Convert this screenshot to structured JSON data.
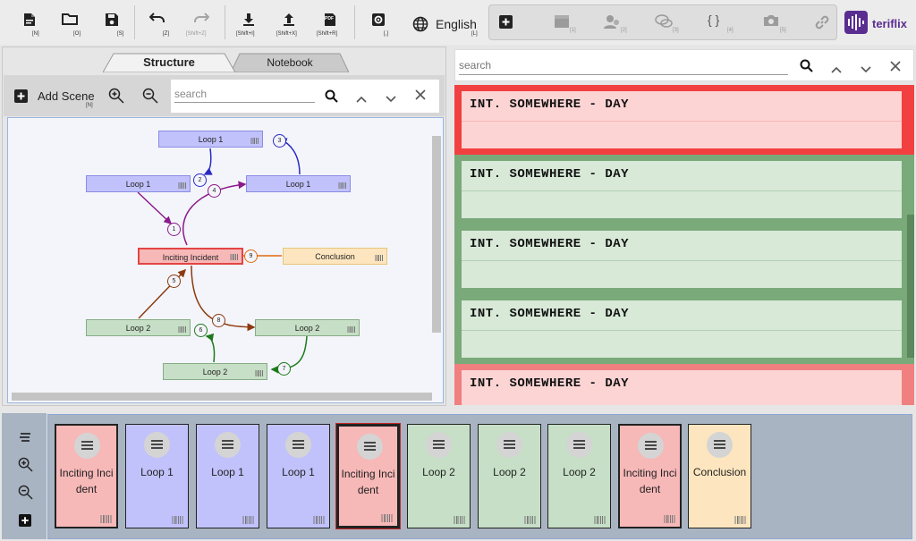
{
  "toolbar": {
    "new_sc": "[N]",
    "open_sc": "[O]",
    "save_sc": "[S]",
    "undo_sc": "[Z]",
    "redo_sc": "[Shift+Z]",
    "import_sc": "[Shift+I]",
    "export_sc": "[Shift+X]",
    "pdf_sc": "[Shift+R]",
    "pdf_badge": "PDF",
    "settings_sc": "[,]",
    "language": "English",
    "language_sc": "[L]",
    "scene_tools_sc": [
      "[1]",
      "[2]",
      "[3]",
      "[4]",
      "[5]"
    ],
    "braces": "{ }",
    "brand": "teriflix"
  },
  "structure": {
    "tabs": [
      "Structure",
      "Notebook"
    ],
    "add_scene_label": "Add Scene",
    "add_scene_sc": "[N]",
    "search_placeholder": "search",
    "nodes": [
      {
        "label": "Loop 1",
        "color": "blue"
      },
      {
        "label": "Loop 1",
        "color": "blue"
      },
      {
        "label": "Loop 1",
        "color": "blue"
      },
      {
        "label": "Inciting Incident",
        "color": "red"
      },
      {
        "label": "Conclusion",
        "color": "yellow"
      },
      {
        "label": "Loop 2",
        "color": "green"
      },
      {
        "label": "Loop 2",
        "color": "green"
      },
      {
        "label": "Loop 2",
        "color": "green"
      }
    ],
    "edges": [
      "1",
      "2",
      "3",
      "4",
      "5",
      "6",
      "7",
      "8",
      "9"
    ]
  },
  "screenplay": {
    "search_placeholder": "search",
    "scenes": [
      {
        "heading": "INT. SOMEWHERE - DAY",
        "color": "red",
        "selected": true
      },
      {
        "heading": "INT. SOMEWHERE - DAY",
        "color": "green"
      },
      {
        "heading": "INT. SOMEWHERE - DAY",
        "color": "green"
      },
      {
        "heading": "INT. SOMEWHERE - DAY",
        "color": "green"
      },
      {
        "heading": "INT. SOMEWHERE - DAY",
        "color": "red"
      }
    ]
  },
  "timeline": {
    "cards": [
      {
        "label": "Inciting Incident",
        "color": "red"
      },
      {
        "label": "Loop 1",
        "color": "blue"
      },
      {
        "label": "Loop 1",
        "color": "blue"
      },
      {
        "label": "Loop 1",
        "color": "blue"
      },
      {
        "label": "Inciting Incident",
        "color": "red",
        "selected": true
      },
      {
        "label": "Loop 2",
        "color": "green"
      },
      {
        "label": "Loop 2",
        "color": "green"
      },
      {
        "label": "Loop 2",
        "color": "green"
      },
      {
        "label": "Inciting Incident",
        "color": "red"
      },
      {
        "label": "Conclusion",
        "color": "yellow"
      }
    ]
  },
  "colors": {
    "red_fill": "#f7b8b8",
    "red_border": "#e24545",
    "blue_fill": "#c1c2fb",
    "blue_border": "#8a8ce6",
    "green_fill": "#c6dfc6",
    "green_border": "#86ad86",
    "yellow_fill": "#fde6bf",
    "yellow_border": "#e8c47e",
    "scene_red": "#f24040",
    "scene_red_inner": "#fdd4d4",
    "scene_green": "#7aa97a",
    "scene_green_inner": "#d8e9d8",
    "brand": "#5a2d91"
  }
}
